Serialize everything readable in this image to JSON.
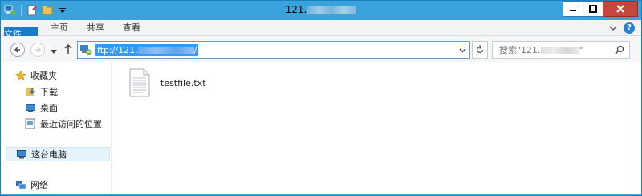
{
  "window": {
    "title_prefix": "121."
  },
  "ribbon": {
    "tabs": [
      "文件",
      "主页",
      "共享",
      "查看"
    ]
  },
  "address": {
    "url_prefix": "ftp://121.",
    "url_suffix": "/"
  },
  "search": {
    "placeholder_prefix": "搜索\"121.",
    "placeholder_suffix": "\""
  },
  "sidebar": {
    "favorites": "收藏夹",
    "items": [
      "下载",
      "桌面",
      "最近访问的位置"
    ],
    "this_pc": "这台电脑",
    "network": "网络"
  },
  "files": [
    {
      "name": "testfile.txt",
      "icon": "text-file-icon"
    }
  ],
  "colors": {
    "titlebar": "#3ba3dc",
    "file_tab": "#1979ca",
    "close_button": "#c7453a",
    "selection": "#3399ff"
  }
}
